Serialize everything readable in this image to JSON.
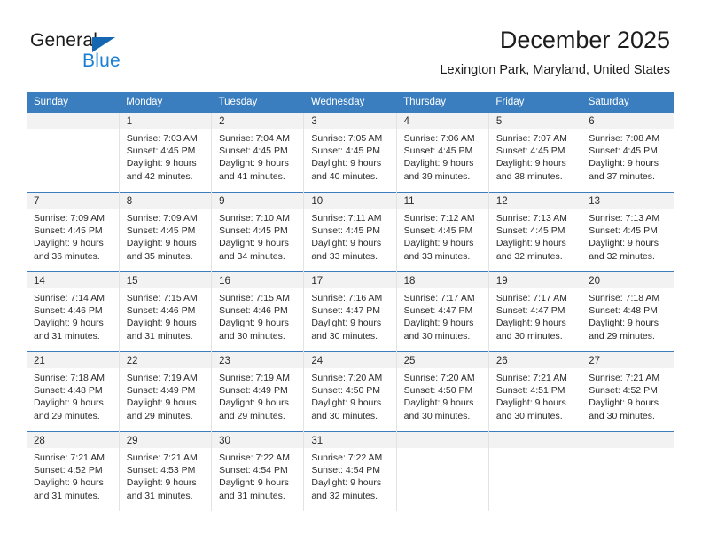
{
  "brand": {
    "name_part1": "General",
    "name_part2": "Blue",
    "triangle_icon": "blue-triangle-logo-mark",
    "accent_color": "#1667b2",
    "accent_color_light": "#1a7fd4"
  },
  "header": {
    "title": "December 2025",
    "subtitle": "Lexington Park, Maryland, United States"
  },
  "theme": {
    "header_row_bg": "#3a7ebf",
    "header_row_text": "#ffffff",
    "daynum_band_bg": "#f2f2f2",
    "cell_border": "#e3e3e3",
    "week_separator": "#3a7ebf"
  },
  "weekdays": [
    "Sunday",
    "Monday",
    "Tuesday",
    "Wednesday",
    "Thursday",
    "Friday",
    "Saturday"
  ],
  "labels": {
    "sunrise_prefix": "Sunrise:",
    "sunset_prefix": "Sunset:",
    "daylight_prefix": "Daylight:"
  },
  "weeks": [
    [
      {
        "day": "",
        "sunrise": "",
        "sunset": "",
        "daylight_line1": "",
        "daylight_line2": ""
      },
      {
        "day": "1",
        "sunrise": "Sunrise: 7:03 AM",
        "sunset": "Sunset: 4:45 PM",
        "daylight_line1": "Daylight: 9 hours",
        "daylight_line2": "and 42 minutes."
      },
      {
        "day": "2",
        "sunrise": "Sunrise: 7:04 AM",
        "sunset": "Sunset: 4:45 PM",
        "daylight_line1": "Daylight: 9 hours",
        "daylight_line2": "and 41 minutes."
      },
      {
        "day": "3",
        "sunrise": "Sunrise: 7:05 AM",
        "sunset": "Sunset: 4:45 PM",
        "daylight_line1": "Daylight: 9 hours",
        "daylight_line2": "and 40 minutes."
      },
      {
        "day": "4",
        "sunrise": "Sunrise: 7:06 AM",
        "sunset": "Sunset: 4:45 PM",
        "daylight_line1": "Daylight: 9 hours",
        "daylight_line2": "and 39 minutes."
      },
      {
        "day": "5",
        "sunrise": "Sunrise: 7:07 AM",
        "sunset": "Sunset: 4:45 PM",
        "daylight_line1": "Daylight: 9 hours",
        "daylight_line2": "and 38 minutes."
      },
      {
        "day": "6",
        "sunrise": "Sunrise: 7:08 AM",
        "sunset": "Sunset: 4:45 PM",
        "daylight_line1": "Daylight: 9 hours",
        "daylight_line2": "and 37 minutes."
      }
    ],
    [
      {
        "day": "7",
        "sunrise": "Sunrise: 7:09 AM",
        "sunset": "Sunset: 4:45 PM",
        "daylight_line1": "Daylight: 9 hours",
        "daylight_line2": "and 36 minutes."
      },
      {
        "day": "8",
        "sunrise": "Sunrise: 7:09 AM",
        "sunset": "Sunset: 4:45 PM",
        "daylight_line1": "Daylight: 9 hours",
        "daylight_line2": "and 35 minutes."
      },
      {
        "day": "9",
        "sunrise": "Sunrise: 7:10 AM",
        "sunset": "Sunset: 4:45 PM",
        "daylight_line1": "Daylight: 9 hours",
        "daylight_line2": "and 34 minutes."
      },
      {
        "day": "10",
        "sunrise": "Sunrise: 7:11 AM",
        "sunset": "Sunset: 4:45 PM",
        "daylight_line1": "Daylight: 9 hours",
        "daylight_line2": "and 33 minutes."
      },
      {
        "day": "11",
        "sunrise": "Sunrise: 7:12 AM",
        "sunset": "Sunset: 4:45 PM",
        "daylight_line1": "Daylight: 9 hours",
        "daylight_line2": "and 33 minutes."
      },
      {
        "day": "12",
        "sunrise": "Sunrise: 7:13 AM",
        "sunset": "Sunset: 4:45 PM",
        "daylight_line1": "Daylight: 9 hours",
        "daylight_line2": "and 32 minutes."
      },
      {
        "day": "13",
        "sunrise": "Sunrise: 7:13 AM",
        "sunset": "Sunset: 4:45 PM",
        "daylight_line1": "Daylight: 9 hours",
        "daylight_line2": "and 32 minutes."
      }
    ],
    [
      {
        "day": "14",
        "sunrise": "Sunrise: 7:14 AM",
        "sunset": "Sunset: 4:46 PM",
        "daylight_line1": "Daylight: 9 hours",
        "daylight_line2": "and 31 minutes."
      },
      {
        "day": "15",
        "sunrise": "Sunrise: 7:15 AM",
        "sunset": "Sunset: 4:46 PM",
        "daylight_line1": "Daylight: 9 hours",
        "daylight_line2": "and 31 minutes."
      },
      {
        "day": "16",
        "sunrise": "Sunrise: 7:15 AM",
        "sunset": "Sunset: 4:46 PM",
        "daylight_line1": "Daylight: 9 hours",
        "daylight_line2": "and 30 minutes."
      },
      {
        "day": "17",
        "sunrise": "Sunrise: 7:16 AM",
        "sunset": "Sunset: 4:47 PM",
        "daylight_line1": "Daylight: 9 hours",
        "daylight_line2": "and 30 minutes."
      },
      {
        "day": "18",
        "sunrise": "Sunrise: 7:17 AM",
        "sunset": "Sunset: 4:47 PM",
        "daylight_line1": "Daylight: 9 hours",
        "daylight_line2": "and 30 minutes."
      },
      {
        "day": "19",
        "sunrise": "Sunrise: 7:17 AM",
        "sunset": "Sunset: 4:47 PM",
        "daylight_line1": "Daylight: 9 hours",
        "daylight_line2": "and 30 minutes."
      },
      {
        "day": "20",
        "sunrise": "Sunrise: 7:18 AM",
        "sunset": "Sunset: 4:48 PM",
        "daylight_line1": "Daylight: 9 hours",
        "daylight_line2": "and 29 minutes."
      }
    ],
    [
      {
        "day": "21",
        "sunrise": "Sunrise: 7:18 AM",
        "sunset": "Sunset: 4:48 PM",
        "daylight_line1": "Daylight: 9 hours",
        "daylight_line2": "and 29 minutes."
      },
      {
        "day": "22",
        "sunrise": "Sunrise: 7:19 AM",
        "sunset": "Sunset: 4:49 PM",
        "daylight_line1": "Daylight: 9 hours",
        "daylight_line2": "and 29 minutes."
      },
      {
        "day": "23",
        "sunrise": "Sunrise: 7:19 AM",
        "sunset": "Sunset: 4:49 PM",
        "daylight_line1": "Daylight: 9 hours",
        "daylight_line2": "and 29 minutes."
      },
      {
        "day": "24",
        "sunrise": "Sunrise: 7:20 AM",
        "sunset": "Sunset: 4:50 PM",
        "daylight_line1": "Daylight: 9 hours",
        "daylight_line2": "and 30 minutes."
      },
      {
        "day": "25",
        "sunrise": "Sunrise: 7:20 AM",
        "sunset": "Sunset: 4:50 PM",
        "daylight_line1": "Daylight: 9 hours",
        "daylight_line2": "and 30 minutes."
      },
      {
        "day": "26",
        "sunrise": "Sunrise: 7:21 AM",
        "sunset": "Sunset: 4:51 PM",
        "daylight_line1": "Daylight: 9 hours",
        "daylight_line2": "and 30 minutes."
      },
      {
        "day": "27",
        "sunrise": "Sunrise: 7:21 AM",
        "sunset": "Sunset: 4:52 PM",
        "daylight_line1": "Daylight: 9 hours",
        "daylight_line2": "and 30 minutes."
      }
    ],
    [
      {
        "day": "28",
        "sunrise": "Sunrise: 7:21 AM",
        "sunset": "Sunset: 4:52 PM",
        "daylight_line1": "Daylight: 9 hours",
        "daylight_line2": "and 31 minutes."
      },
      {
        "day": "29",
        "sunrise": "Sunrise: 7:21 AM",
        "sunset": "Sunset: 4:53 PM",
        "daylight_line1": "Daylight: 9 hours",
        "daylight_line2": "and 31 minutes."
      },
      {
        "day": "30",
        "sunrise": "Sunrise: 7:22 AM",
        "sunset": "Sunset: 4:54 PM",
        "daylight_line1": "Daylight: 9 hours",
        "daylight_line2": "and 31 minutes."
      },
      {
        "day": "31",
        "sunrise": "Sunrise: 7:22 AM",
        "sunset": "Sunset: 4:54 PM",
        "daylight_line1": "Daylight: 9 hours",
        "daylight_line2": "and 32 minutes."
      },
      {
        "day": "",
        "sunrise": "",
        "sunset": "",
        "daylight_line1": "",
        "daylight_line2": ""
      },
      {
        "day": "",
        "sunrise": "",
        "sunset": "",
        "daylight_line1": "",
        "daylight_line2": ""
      },
      {
        "day": "",
        "sunrise": "",
        "sunset": "",
        "daylight_line1": "",
        "daylight_line2": ""
      }
    ]
  ]
}
